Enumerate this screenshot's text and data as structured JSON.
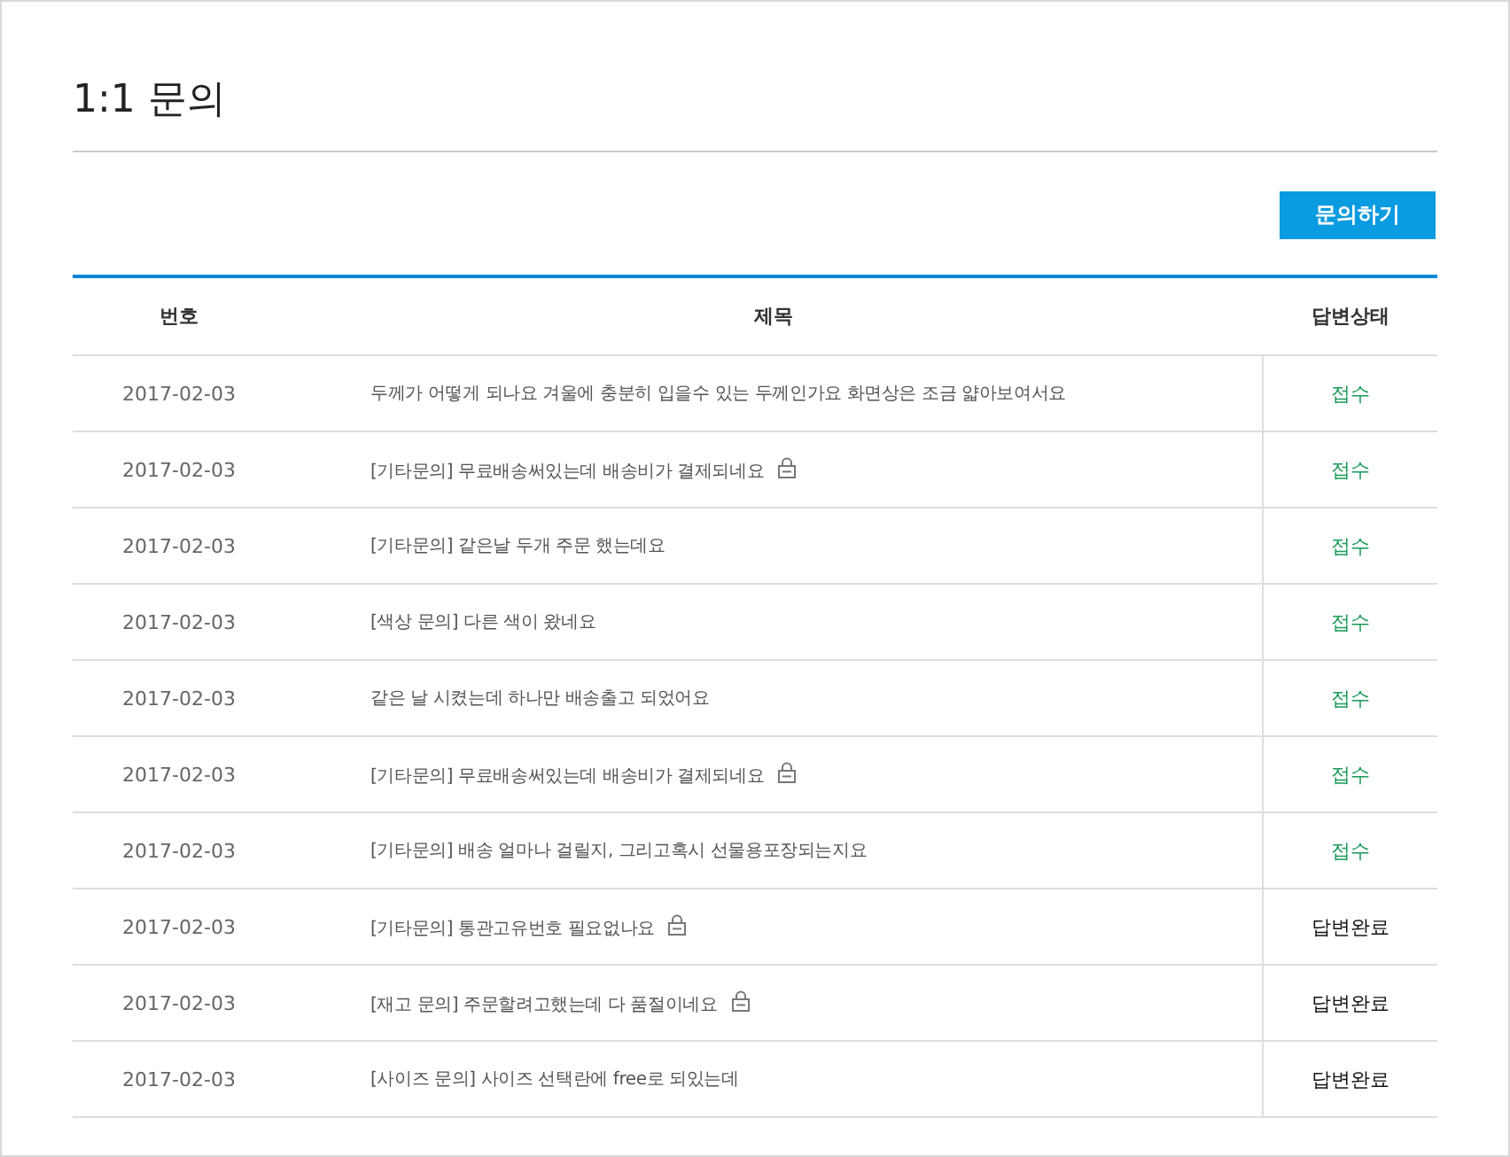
{
  "title": "1:1 문의",
  "ask_button": "문의하기",
  "table": {
    "columns": [
      "번호",
      "제목",
      "답변상태"
    ],
    "rows": [
      {
        "date": "2017-02-03",
        "subject": "두께가 어떻게 되나요 겨울에 충분히 입을수 있는 두께인가요 화면상은 조금 얇아보여서요",
        "locked": false,
        "status": "접수",
        "kind": "received"
      },
      {
        "date": "2017-02-03",
        "subject": "[기타문의]  무료배송써있는데 배송비가 결제되네요",
        "locked": true,
        "status": "접수",
        "kind": "received"
      },
      {
        "date": "2017-02-03",
        "subject": "[기타문의]  같은날 두개 주문 했는데요",
        "locked": false,
        "status": "접수",
        "kind": "received"
      },
      {
        "date": "2017-02-03",
        "subject": "[색상 문의] 다른 색이 왔네요",
        "locked": false,
        "status": "접수",
        "kind": "received"
      },
      {
        "date": "2017-02-03",
        "subject": "같은 날 시켰는데 하나만 배송출고 되었어요",
        "locked": false,
        "status": "접수",
        "kind": "received"
      },
      {
        "date": "2017-02-03",
        "subject": "[기타문의] 무료배송써있는데 배송비가 결제되네요",
        "locked": true,
        "status": "접수",
        "kind": "received"
      },
      {
        "date": "2017-02-03",
        "subject": "[기타문의] 배송 얼마나 걸릴지, 그리고혹시 선물용포장되는지요",
        "locked": false,
        "status": "접수",
        "kind": "received"
      },
      {
        "date": "2017-02-03",
        "subject": "[기타문의] 통관고유번호 필요없나요",
        "locked": true,
        "status": "답변완료",
        "kind": "answered"
      },
      {
        "date": "2017-02-03",
        "subject": "[재고 문의] 주문할려고했는데 다 품절이네요",
        "locked": true,
        "status": "답변완료",
        "kind": "answered"
      },
      {
        "date": "2017-02-03",
        "subject": "[사이즈 문의] 사이즈 선택란에 free로 되있는데",
        "locked": false,
        "status": "답변완료",
        "kind": "answered"
      }
    ]
  }
}
